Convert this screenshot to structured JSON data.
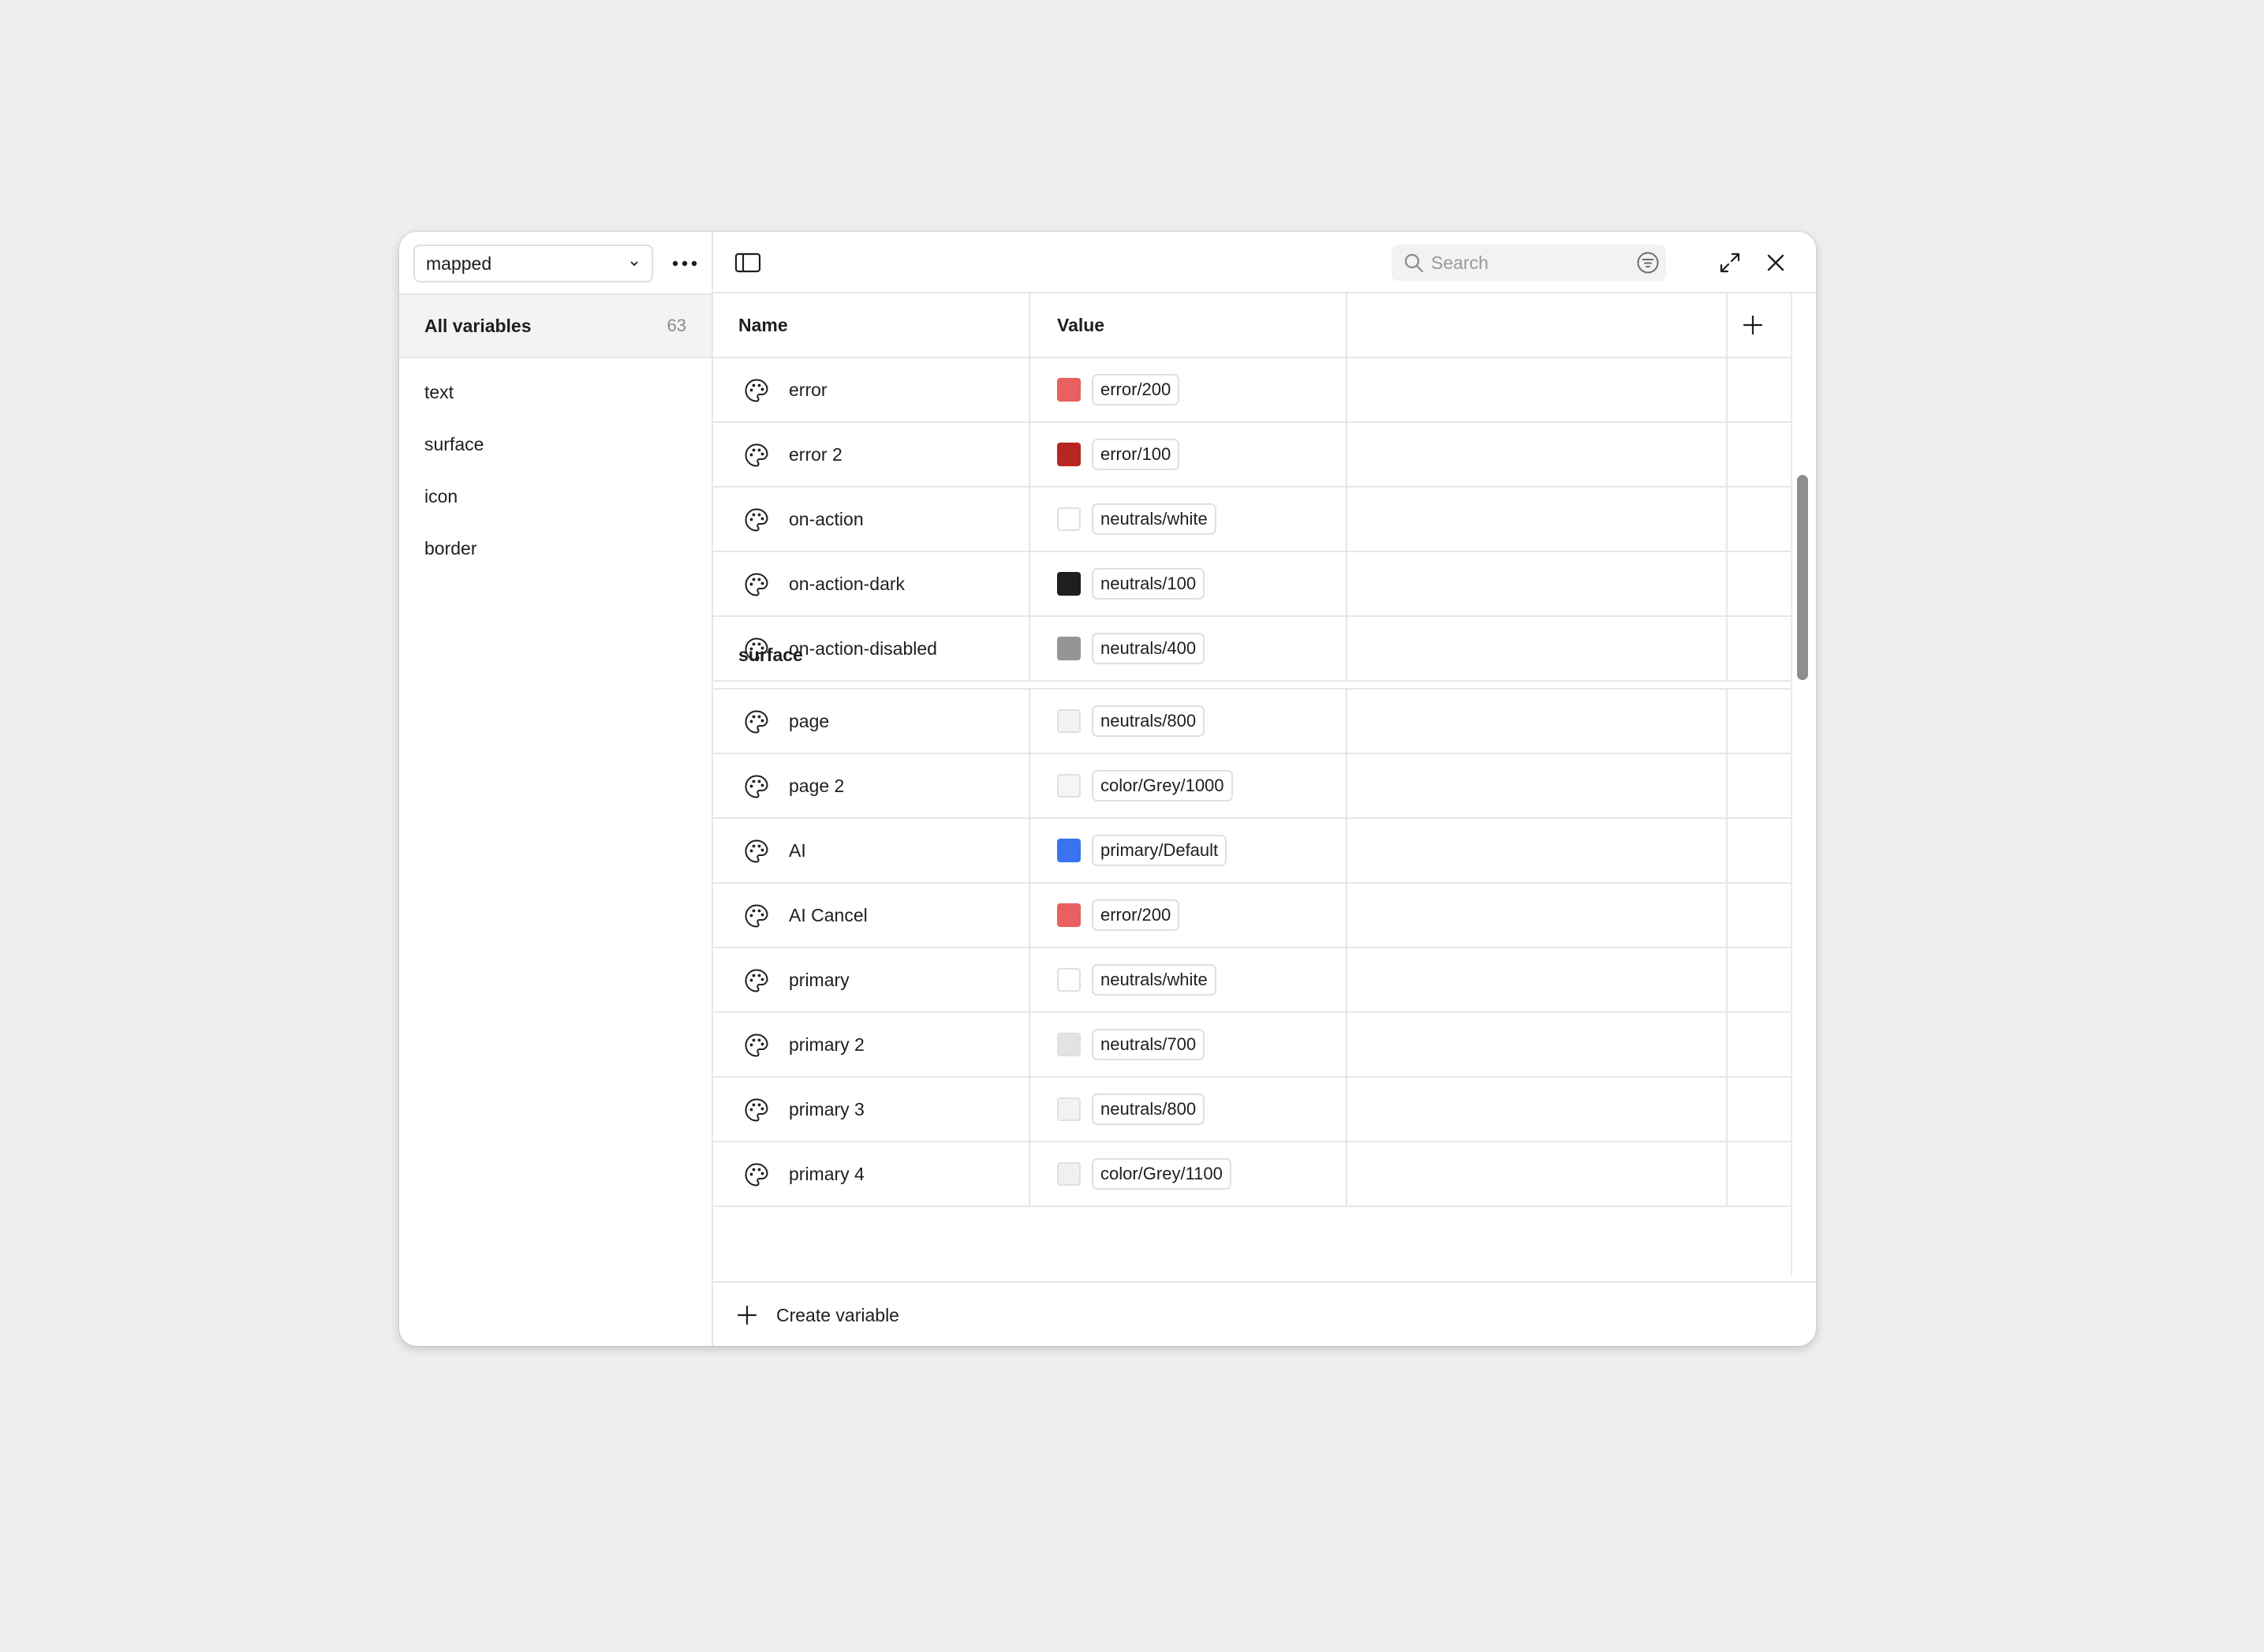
{
  "sidebar": {
    "collection": "mapped",
    "all_variables_label": "All variables",
    "all_variables_count": "63",
    "groups": [
      "text",
      "surface",
      "icon",
      "border"
    ]
  },
  "toolbar": {
    "search_placeholder": "Search"
  },
  "table": {
    "headers": {
      "name": "Name",
      "value": "Value"
    },
    "rows_top": [
      {
        "name": "error",
        "alias": "error/200",
        "color": "#e8605f"
      },
      {
        "name": "error 2",
        "alias": "error/100",
        "color": "#b8271f"
      },
      {
        "name": "on-action",
        "alias": "neutrals/white",
        "color": "#ffffff"
      },
      {
        "name": "on-action-dark",
        "alias": "neutrals/100",
        "color": "#1e1e1e"
      },
      {
        "name": "on-action-disabled",
        "alias": "neutrals/400",
        "color": "#959595"
      }
    ],
    "section_title": "surface",
    "rows_surface": [
      {
        "name": "page",
        "alias": "neutrals/800",
        "color": "#f2f2f2"
      },
      {
        "name": "page 2",
        "alias": "color/Grey/1000",
        "color": "#f5f5f5"
      },
      {
        "name": "AI",
        "alias": "primary/Default",
        "color": "#3a73f0"
      },
      {
        "name": "AI Cancel",
        "alias": "error/200",
        "color": "#e8605f"
      },
      {
        "name": "primary",
        "alias": "neutrals/white",
        "color": "#ffffff"
      },
      {
        "name": "primary 2",
        "alias": "neutrals/700",
        "color": "#e3e3e3"
      },
      {
        "name": "primary 3",
        "alias": "neutrals/800",
        "color": "#f2f2f2"
      },
      {
        "name": "primary 4",
        "alias": "color/Grey/1100",
        "color": "#f0f0f0"
      }
    ]
  },
  "footer": {
    "create_label": "Create variable"
  }
}
